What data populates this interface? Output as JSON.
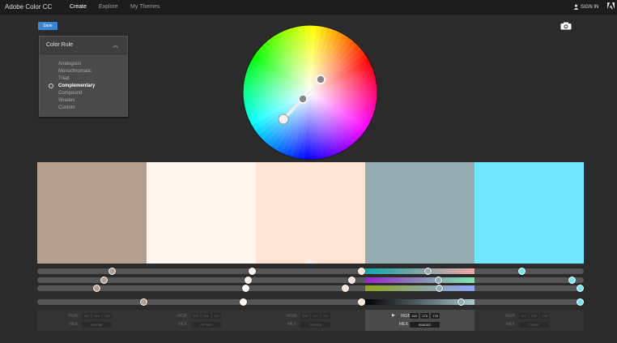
{
  "topbar": {
    "brand": "Adobe Color CC",
    "nav": [
      "Create",
      "Explore",
      "My Themes"
    ],
    "active_nav": "Create",
    "sign_in": "SIGN IN"
  },
  "toolbar": {
    "save_label": "Save",
    "camera_icon": "camera-icon"
  },
  "color_rule": {
    "title": "Color Rule",
    "items": [
      "Analogous",
      "Monochromatic",
      "Triad",
      "Complementary",
      "Compound",
      "Shades",
      "Custom"
    ],
    "selected": "Complementary"
  },
  "swatches": [
    {
      "hex": "#B49F8E",
      "rgb": [
        180,
        159,
        142
      ]
    },
    {
      "hex": "#FFF6F0",
      "rgb": [
        255,
        246,
        240
      ]
    },
    {
      "hex": "#FFE3D3",
      "rgb": [
        255,
        227,
        211
      ]
    },
    {
      "hex": "#95ADB2",
      "rgb": [
        149,
        173,
        178
      ]
    },
    {
      "hex": "#70E8FF",
      "rgb": [
        112,
        232,
        255
      ]
    }
  ],
  "selected_swatch": 3,
  "values": {
    "rgb_label": "RGB",
    "hex_label": "HEX",
    "cells": [
      {
        "r": "180",
        "g": "159",
        "b": "142",
        "hex": "B49F8E"
      },
      {
        "r": "255",
        "g": "246",
        "b": "240",
        "hex": "FFF6F0"
      },
      {
        "r": "255",
        "g": "227",
        "b": "211",
        "hex": "FFE3D3"
      },
      {
        "r": "149",
        "g": "173",
        "b": "178",
        "hex": "95ADB2"
      },
      {
        "r": "112",
        "g": "232",
        "b": "255",
        "hex": "70E8FF"
      }
    ]
  },
  "accent": "#3a86d0"
}
